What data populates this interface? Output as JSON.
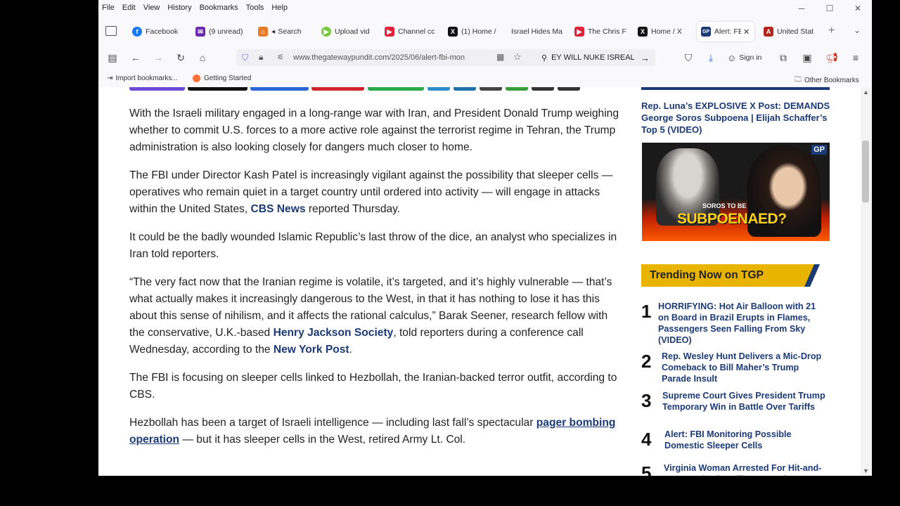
{
  "menu": [
    "File",
    "Edit",
    "View",
    "History",
    "Bookmarks",
    "Tools",
    "Help"
  ],
  "tabs": [
    {
      "label": "Facebook",
      "color": "#1877f2",
      "glyph": "f"
    },
    {
      "label": "(9 unread)",
      "color": "#6a2bb0",
      "glyph": "✉"
    },
    {
      "label": "Search",
      "color": "#e87a2b",
      "glyph": "⌂"
    },
    {
      "label": "Upload vid",
      "color": "#7ac943",
      "glyph": "▶"
    },
    {
      "label": "Channel cc",
      "color": "#e0233b",
      "glyph": "▶"
    },
    {
      "label": "(1) Home /",
      "color": "#111111",
      "glyph": "X"
    },
    {
      "label": "Israel Hides Ma",
      "color": "#ffffff",
      "glyph": ""
    },
    {
      "label": "The Chris F",
      "color": "#e0233b",
      "glyph": "▶"
    },
    {
      "label": "Home / X",
      "color": "#111111",
      "glyph": "X"
    },
    {
      "label": "Alert: FB",
      "color": "#1b3a78",
      "glyph": "GP"
    },
    {
      "label": "United Stat",
      "color": "#b3261e",
      "glyph": "A"
    }
  ],
  "nav": {
    "url": "www.thegatewaypundit.com/2025/06/alert-fbi-mon",
    "search_query": "EY WILL NUKE ISREAL",
    "signin": "Sign in"
  },
  "bookmarks": {
    "import": "Import bookmarks...",
    "getting_started": "Getting Started",
    "other": "Other Bookmarks"
  },
  "article": {
    "p1": "With the Israeli military engaged in a long-range war with Iran, and President Donald Trump weighing whether to commit U.S. forces to a more active role against the terrorist regime in Tehran, the Trump administration is also looking closely for dangers much closer to home.",
    "p2_a": "The FBI under Director Kash Patel is increasingly vigilant against the possibility that sleeper cells — operatives who remain quiet in a target country until ordered into activity — will engage in attacks within the United States, ",
    "p2_link": "CBS News",
    "p2_b": " reported Thursday.",
    "p3": "It could be the badly wounded Islamic Republic’s last throw of the dice, an analyst who specializes in Iran told reporters.",
    "p4_a": "“The very fact now that the Iranian regime is volatile, it’s targeted, and it’s highly vulnerable — that’s what actually makes it increasingly dangerous to the West, in that it has nothing to lose it has this about this sense of nihilism, and it affects the rational calculus,” Barak Seener, research fellow with the conservative, U.K.-based ",
    "p4_link1": "Henry Jackson Society",
    "p4_b": ", told reporters during a conference call Wednesday, according to the ",
    "p4_link2": "New York Post",
    "p4_c": ".",
    "p5": "The FBI is focusing on sleeper cells linked to Hezbollah, the Iranian-backed terror outfit, according to CBS.",
    "p6_a": "Hezbollah has been a target of Israeli intelligence — including last fall’s spectacular ",
    "p6_link": "pager bombing operation",
    "p6_b": " — but it has sleeper cells in the West, retired Army Lt. Col."
  },
  "sidebar": {
    "promo_title": "Rep. Luna’s EXPLOSIVE X Post: DEMANDS George Soros Subpoena | Elijah Schaffer’s Top 5 (VIDEO)",
    "promo_caption_1": "SOROS TO BE",
    "promo_caption_2": "SUBPOENAED?",
    "promo_badge": "GP",
    "trending_label": "Trending Now on TGP",
    "trending": [
      {
        "num": "1",
        "title": "HORRIFYING: Hot Air Balloon with 21 on Board in Brazil Erupts in Flames, Passengers Seen Falling From Sky (VIDEO)"
      },
      {
        "num": "2",
        "title": "Rep. Wesley Hunt Delivers a Mic-Drop Comeback to Bill Maher’s Trump Parade Insult"
      },
      {
        "num": "3",
        "title": "Supreme Court Gives President Trump Temporary Win in Battle Over Tariffs"
      },
      {
        "num": "4",
        "title": "Alert: FBI Monitoring Possible Domestic Sleeper Cells"
      },
      {
        "num": "5",
        "title": "Virginia Woman Arrested For Hit-and-Run Death of Netflix Star and"
      }
    ]
  },
  "colors": {
    "link": "#1b3a78",
    "trend_banner": "#e8b400",
    "trend_banner_edge": "#1b3a78"
  }
}
